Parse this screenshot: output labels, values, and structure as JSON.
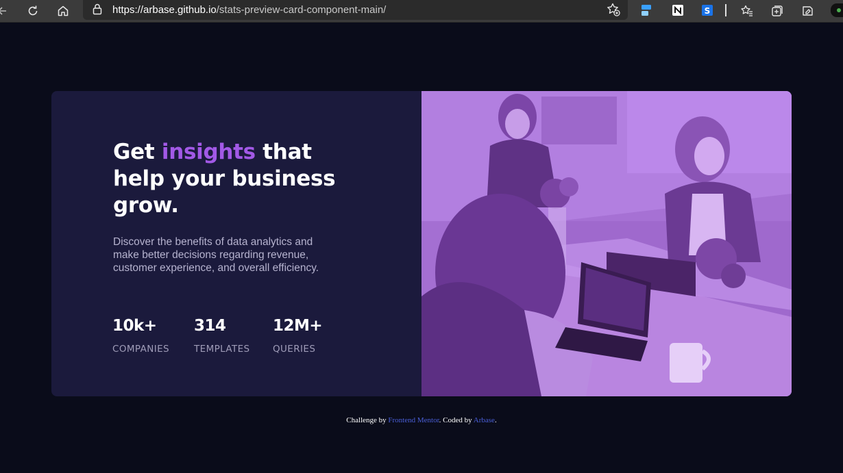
{
  "browser": {
    "url_host": "https://arbase.github.io",
    "url_path": "/stats-preview-card-component-main/",
    "icons": [
      "back-icon",
      "reload-icon",
      "home-icon",
      "lock-icon",
      "add-favorite-icon",
      "extension-icon",
      "notion-icon",
      "extension-s-icon",
      "favorites-icon",
      "collections-icon",
      "profile-icon"
    ]
  },
  "card": {
    "headline_part1": "Get ",
    "headline_accent": "insights",
    "headline_part2": " that help your business grow.",
    "description": "Discover the benefits of data analytics and make better decisions regarding revenue, customer experience, and overall efficiency.",
    "stats": [
      {
        "value": "10k+",
        "label": "COMPANIES"
      },
      {
        "value": "314",
        "label": "TEMPLATES"
      },
      {
        "value": "12M+",
        "label": "QUERIES"
      }
    ]
  },
  "attribution": {
    "prefix": "Challenge by ",
    "challenge_link": "Frontend Mentor",
    "middle": ". Coded by ",
    "author_link": "Arbase",
    "suffix": "."
  },
  "colors": {
    "page_bg": "#0a0c1a",
    "card_bg": "#1b1a3c",
    "accent": "#a259e6",
    "photo_overlay": "#a870d4",
    "link": "#4a5fd8"
  }
}
